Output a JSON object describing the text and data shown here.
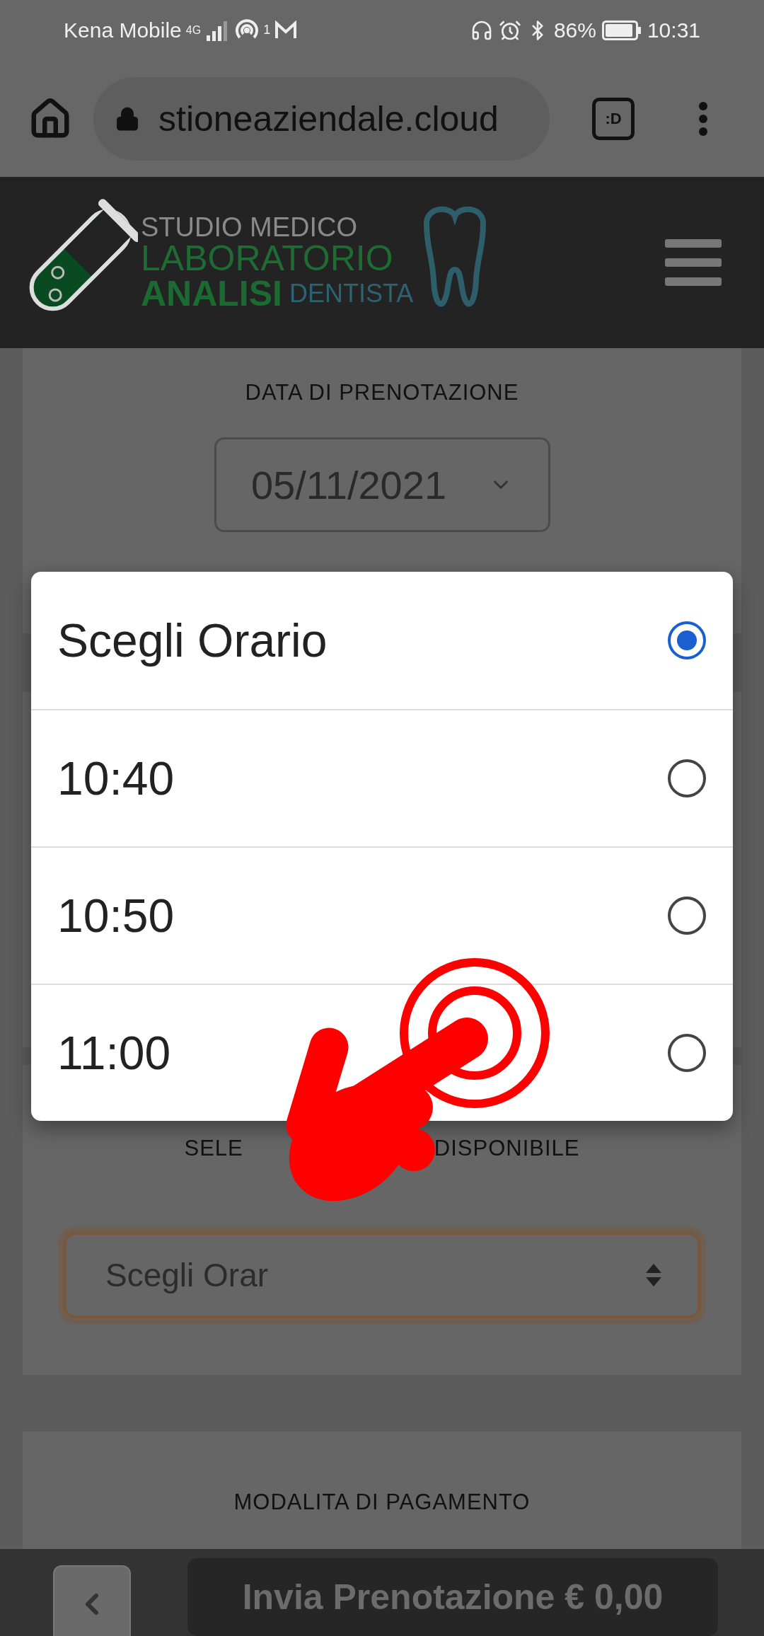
{
  "status_bar": {
    "carrier": "Kena Mobile",
    "network": "4G",
    "hotspot_count": "1",
    "battery": "86%",
    "time": "10:31"
  },
  "browser": {
    "url": "stioneaziendale.cloud",
    "tabs_label": ":D"
  },
  "logo": {
    "line_1": "STUDIO MEDICO",
    "line_2": "LABORATORIO",
    "line_3": "ANALISI",
    "line_4": "DENTISTA"
  },
  "date_section": {
    "label": "DATA DI PRENOTAZIONE",
    "value": "05/11/2021"
  },
  "time_dialog": {
    "options": [
      {
        "label": "Scegli Orario",
        "selected": true
      },
      {
        "label": "10:40",
        "selected": false
      },
      {
        "label": "10:50",
        "selected": false
      },
      {
        "label": "11:00",
        "selected": false
      }
    ]
  },
  "time_section": {
    "label_start": "SELE",
    "label_end": "DISPONIBILE",
    "value": "Scegli Orar"
  },
  "payment_section": {
    "label": "MODALITA DI PAGAMENTO"
  },
  "bottom_bar": {
    "submit": "Invia Prenotazione € 0,00"
  }
}
